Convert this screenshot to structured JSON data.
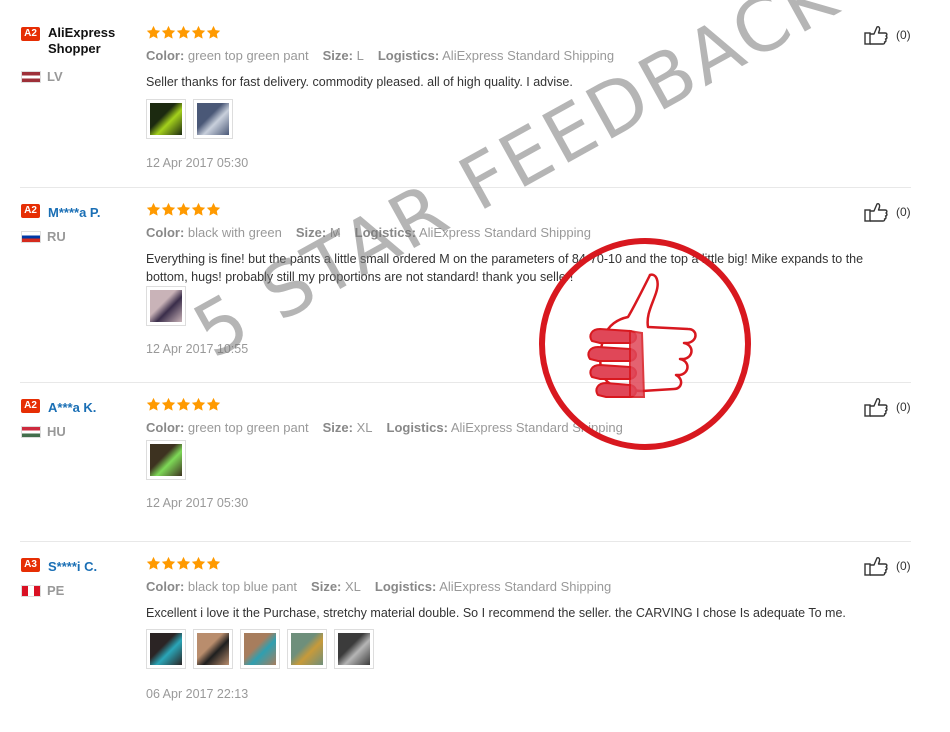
{
  "reviews": [
    {
      "badge": "A2",
      "user": "AliExpress Shopper",
      "country": "LV",
      "flag": [
        "#9e3039",
        "#ffffff",
        "#9e3039"
      ],
      "stars": 5,
      "color_label": "Color:",
      "color": "green top green pant",
      "size_label": "Size:",
      "size": "L",
      "logistics_label": "Logistics:",
      "logistics": "AliExpress Standard Shipping",
      "text": "Seller thanks for fast delivery. commodity pleased. all of high quality. I advise.",
      "thumbs": [
        [
          "#1c2a10",
          "#a4d11c"
        ],
        [
          "#4a5877",
          "#c9d0dc"
        ]
      ],
      "date": "12 Apr 2017 05:30",
      "likes": "(0)"
    },
    {
      "badge": "A2",
      "user": "M****a P.",
      "country": "RU",
      "flag": [
        "#ffffff",
        "#0039a6",
        "#d52b1e"
      ],
      "stars": 5,
      "color_label": "Color:",
      "color": "black with green",
      "size_label": "Size:",
      "size": "M",
      "logistics_label": "Logistics:",
      "logistics": "AliExpress Standard Shipping",
      "text": "Everything is fine! but the pants a little small ordered M on the parameters of 84-70-10 and the top a little big! Mike expands to the bottom, hugs! probably still my proportions are not standard! thank you seller!",
      "thumbs": [
        [
          "#c9b3b8",
          "#3a2d4a"
        ]
      ],
      "date": "12 Apr 2017 10:55",
      "likes": "(0)"
    },
    {
      "badge": "A2",
      "user": "A***a K.",
      "country": "HU",
      "flag": [
        "#cd2a3e",
        "#ffffff",
        "#436f4d"
      ],
      "stars": 5,
      "color_label": "Color:",
      "color": "green top green pant",
      "size_label": "Size:",
      "size": "XL",
      "logistics_label": "Logistics:",
      "logistics": "AliExpress Standard Shipping",
      "text": "",
      "thumbs": [
        [
          "#3d3220",
          "#7ed957"
        ]
      ],
      "date": "12 Apr 2017 05:30",
      "likes": "(0)"
    },
    {
      "badge": "A3",
      "user": "S****i C.",
      "country": "PE",
      "flag": [
        "#d91023",
        "#ffffff",
        "#d91023"
      ],
      "stars": 5,
      "color_label": "Color:",
      "color": "black top blue pant",
      "size_label": "Size:",
      "size": "XL",
      "logistics_label": "Logistics:",
      "logistics": "AliExpress Standard Shipping",
      "text": "Excellent i love it the Purchase, stretchy material double. So I recommend the seller. the CARVING I chose Is adequate To me.",
      "thumbs": [
        [
          "#2b2424",
          "#2aa6b8"
        ],
        [
          "#b98d6d",
          "#1f1f1f"
        ],
        [
          "#a77d5d",
          "#2f9fb0"
        ],
        [
          "#6e8f7b",
          "#c79a3a"
        ],
        [
          "#3b3b3b",
          "#b5b5b5"
        ]
      ],
      "date": "06 Apr 2017 22:13",
      "likes": "(0)"
    }
  ],
  "overlay": {
    "watermark": "5 STAR FEEDBACK",
    "stamp_color": "#d8181f"
  },
  "colors": {
    "star": "#ff9a00",
    "username": "#1a6fb5",
    "badge": "#e62e04"
  }
}
